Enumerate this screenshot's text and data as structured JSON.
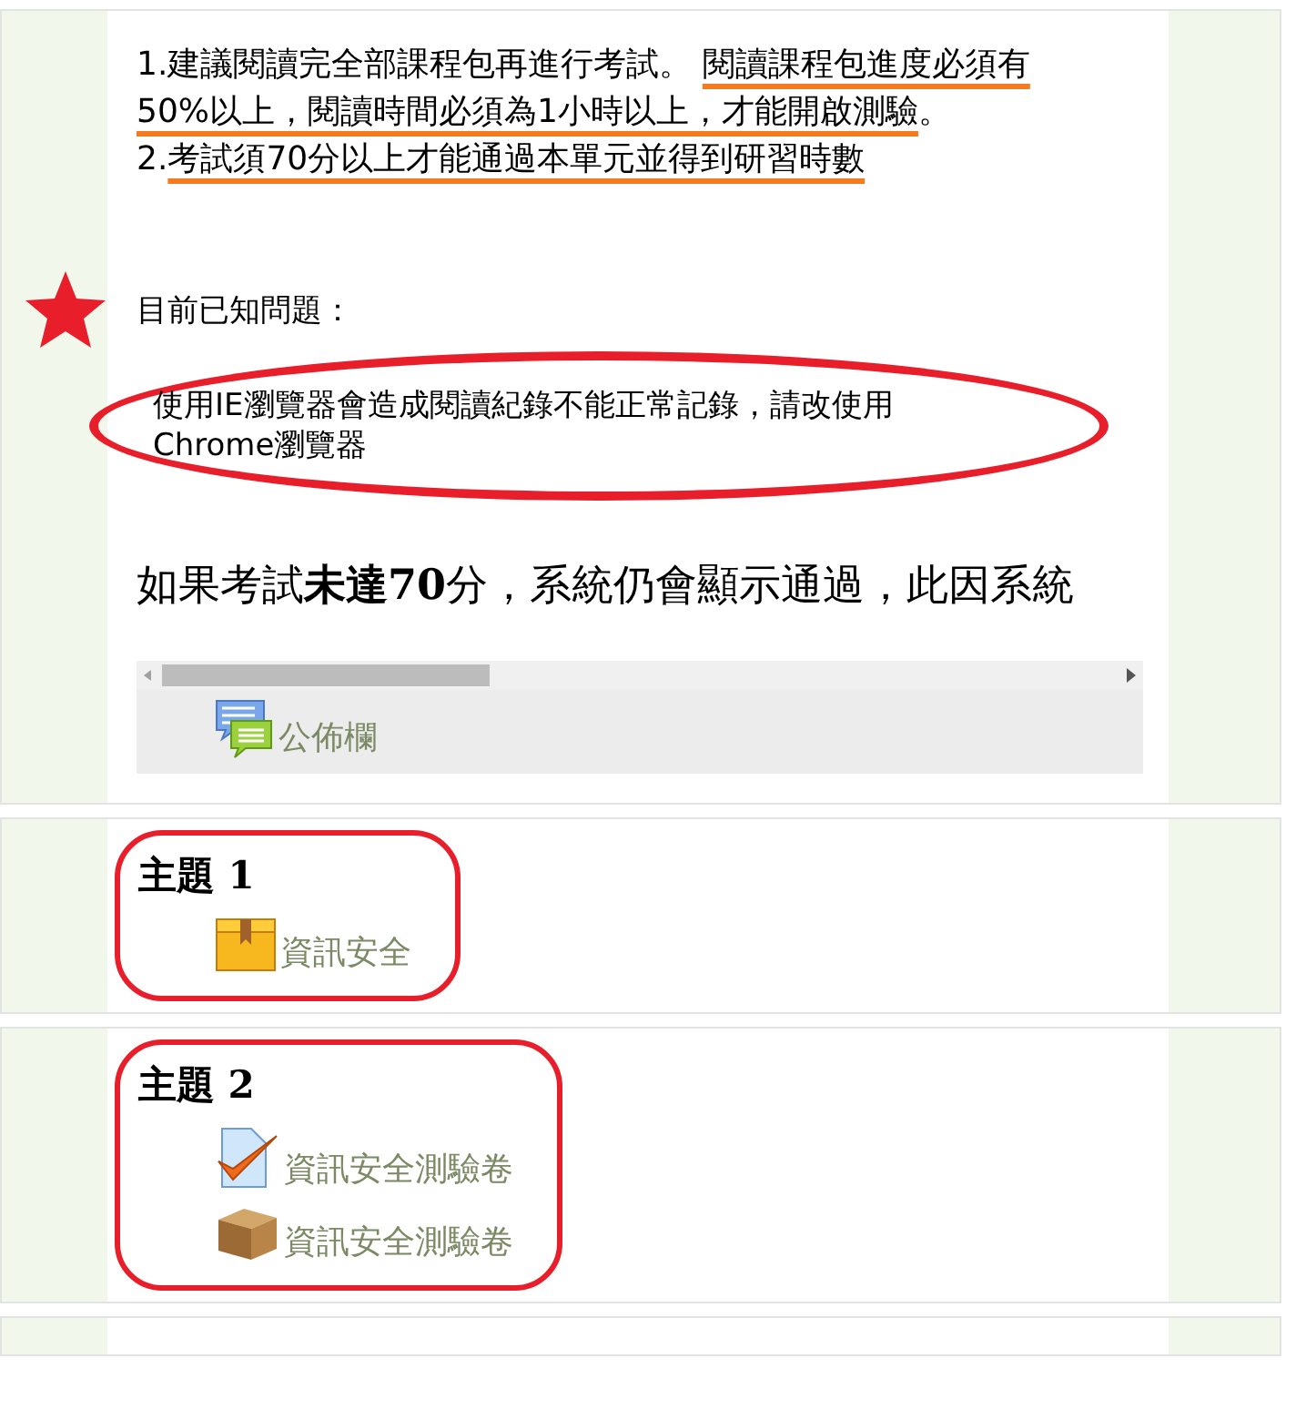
{
  "intro": {
    "paragraphs": [
      {
        "segments": [
          {
            "text": "1.建議閱讀完全部課程包再進行考試。 ",
            "underlined": false
          },
          {
            "text": "閱讀課程包進度必須有50%以上，閱讀時間必須為1小時以上，才能開啟測驗",
            "underlined": true
          },
          {
            "text": "。",
            "underlined": false
          }
        ]
      },
      {
        "segments": [
          {
            "text": "2.",
            "underlined": false
          },
          {
            "text": "考試須70分以上才能通過本單元並得到研習時數",
            "underlined": true
          }
        ]
      }
    ],
    "notice": {
      "heading": "目前已知問題：",
      "starred": true,
      "text": "使用IE瀏覽器會造成閱讀紀錄不能正常記錄，請改使用Chrome瀏覽器",
      "circled": true
    },
    "wide_text": "如果考試**未達70**分，系統仍會顯示通過，此因系統",
    "activities": [
      {
        "kind": "forum",
        "label": "公佈欄"
      }
    ]
  },
  "topics": [
    {
      "title": "主題 1",
      "circled": true,
      "activities": [
        {
          "kind": "package",
          "label": "資訊安全"
        }
      ]
    },
    {
      "title": "主題 2",
      "circled": true,
      "activities": [
        {
          "kind": "quiz",
          "label": "資訊安全測驗卷"
        },
        {
          "kind": "scorm",
          "label": "資訊安全測驗卷"
        }
      ]
    }
  ]
}
